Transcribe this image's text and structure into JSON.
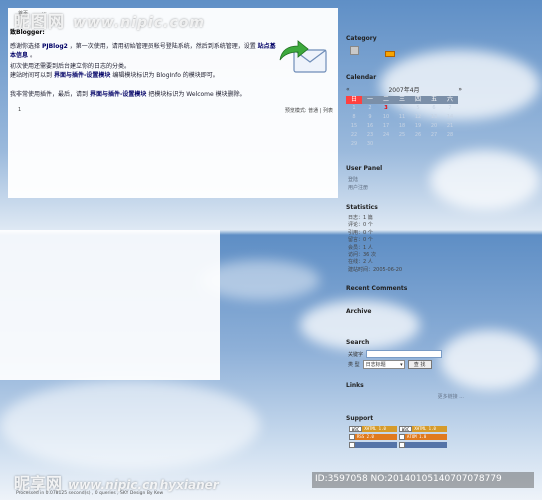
{
  "watermark": {
    "site_name_top": "昵图网",
    "site_url_top": "www.nipic.com",
    "site_name_bottom": "昵享网",
    "site_url_bottom": "www.nipic.cn",
    "author": "hyxianer",
    "id_text": "ID:3597058 NO:20140105140707078779"
  },
  "main": {
    "nav": [
      "首页",
      "⋯"
    ],
    "greeting": "致Blogger:",
    "para1_a": "感谢你选择",
    "para1_product": "PJBlog2",
    "para1_b": "，第一次使用，请用初始管理员帐号登陆系统，然后到系统管理，设置",
    "para1_link": "站点基本信息",
    "para1_c": "。",
    "para2": "初次使用还需要到后台建立你的日志的分类。",
    "para2_b": "建站时间可以到",
    "para2_link": "界面与插件-设置模块",
    "para2_c": "编辑模块标识为 BlogInfo 的模块即可。",
    "para3_a": "我非常使用插件，最后，请到",
    "para3_link": "界面与插件-设置模块",
    "para3_b": "把模块标识为 Welcome 模块删除。",
    "entry_num": "1",
    "view_mode": "预览模式: 普通 | 列表"
  },
  "sidebar": {
    "category_title": "Category",
    "calendar_title": "Calendar",
    "calendar_prev": "«",
    "calendar_month": "2007年4月",
    "calendar_next": "»",
    "weekdays": [
      "日",
      "一",
      "二",
      "三",
      "四",
      "五",
      "六"
    ],
    "days": [
      "1",
      "2",
      "3",
      "4",
      "5",
      "6",
      "7",
      "8",
      "9",
      "10",
      "11",
      "12",
      "13",
      "14",
      "15",
      "16",
      "17",
      "18",
      "19",
      "20",
      "21",
      "22",
      "23",
      "24",
      "25",
      "26",
      "27",
      "28",
      "29",
      "30",
      "",
      "",
      "",
      "",
      ""
    ],
    "today": "3",
    "user_panel_title": "User Panel",
    "user_links": [
      "登陆",
      "用户注册"
    ],
    "statistics_title": "Statistics",
    "stats": [
      "日志：1 篇",
      "评论：0 个",
      "引用：0 个",
      "留言：0 个",
      "会员：1 人",
      "访问：36 次",
      "在线：2 人",
      "建站时间：2005-06-20"
    ],
    "recent_comments_title": "Recent Comments",
    "archive_title": "Archive",
    "search_title": "Search",
    "search_label": "关键字",
    "search_value": "",
    "search_type_label": "类 型",
    "search_type_value": "日志标题",
    "search_button": "查 找",
    "links_title": "Links",
    "more_links": "更多链接 ...",
    "support_title": "Support",
    "badges": [
      {
        "left": "W3C",
        "right": "XHTML 1.0",
        "color": "#d69b2b"
      },
      {
        "left": "W3C",
        "right": "XHTML 1.0",
        "color": "#d69b2b"
      },
      {
        "left": "",
        "right": "RSS 2.0",
        "color": "#e07a1f"
      },
      {
        "left": "",
        "right": "ATOM 1.0",
        "color": "#e07a1f"
      },
      {
        "left": "",
        "right": "",
        "color": "#5574a8"
      },
      {
        "left": "",
        "right": "",
        "color": "#5574a8"
      }
    ]
  },
  "footer": "Processed in 0.078125 second(s) , 0 queries , SKY Design By Kew"
}
